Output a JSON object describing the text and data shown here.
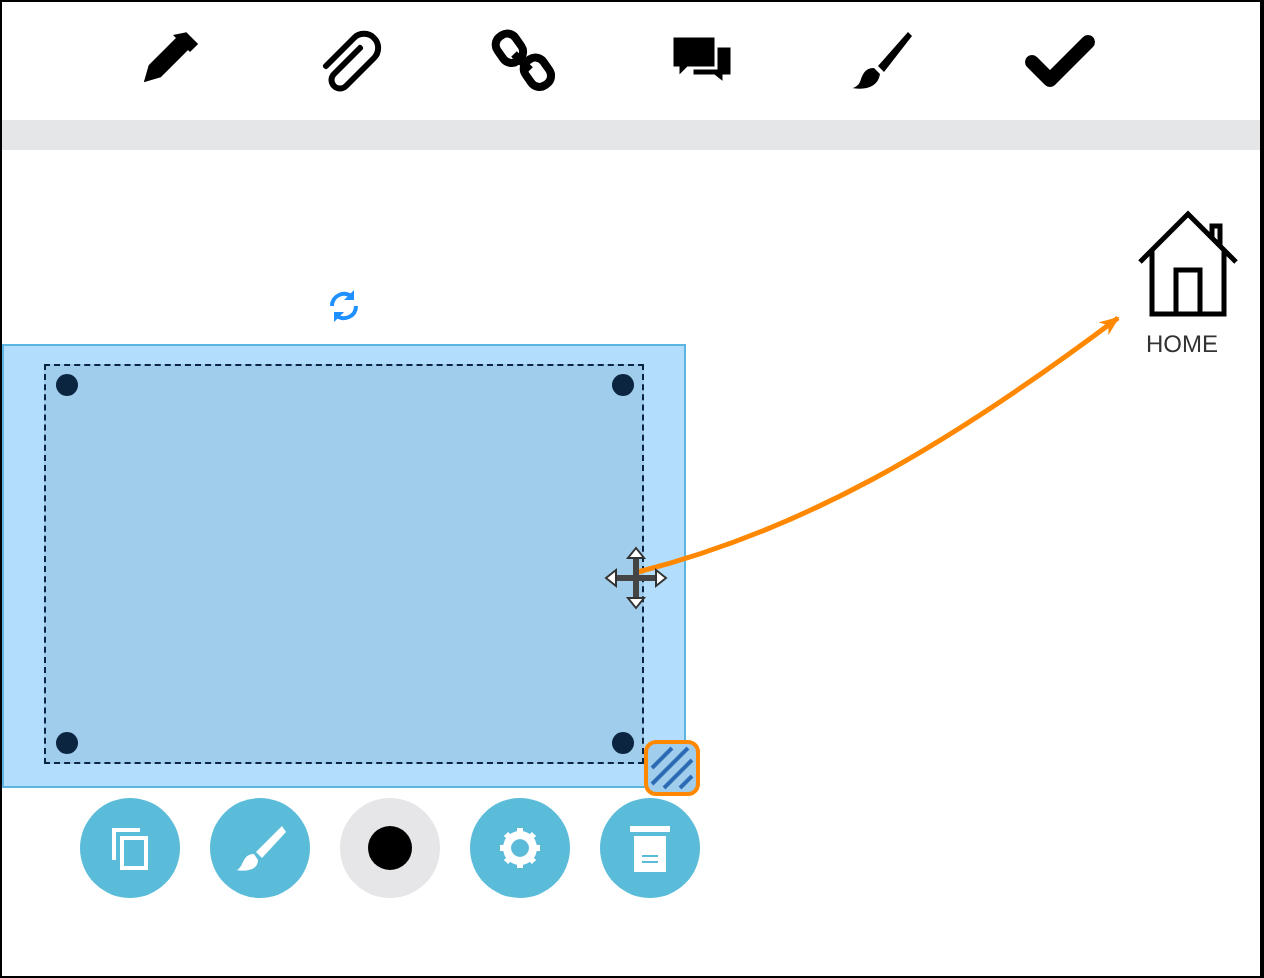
{
  "toolbar": {
    "tools": [
      {
        "kind": "pencil"
      },
      {
        "kind": "paperclip"
      },
      {
        "kind": "link"
      },
      {
        "kind": "chat"
      },
      {
        "kind": "brush"
      },
      {
        "kind": "check"
      }
    ]
  },
  "canvas": {
    "home": {
      "label": "HOME"
    }
  },
  "shape_actions": [
    {
      "kind": "copy"
    },
    {
      "kind": "brush"
    },
    {
      "kind": "color"
    },
    {
      "kind": "settings"
    },
    {
      "kind": "delete"
    }
  ]
}
